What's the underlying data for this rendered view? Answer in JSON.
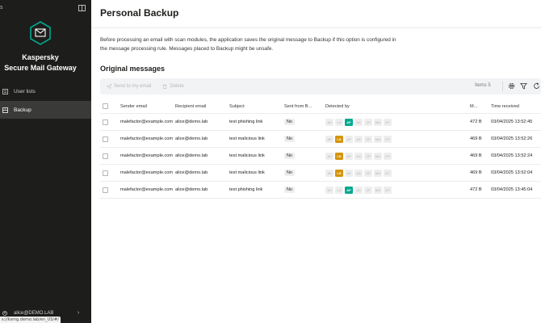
{
  "sidebar": {
    "top_left_glyph": "s",
    "brand_line1": "Kaspersky",
    "brand_line2": "Secure Mail Gateway",
    "items": [
      {
        "label": "User lists",
        "active": false
      },
      {
        "label": "Backup",
        "active": true
      }
    ],
    "user": "alice@DEMO.LAB"
  },
  "statusbar": {
    "url": "s://ksmg.demo.lab/en_US/#/"
  },
  "page": {
    "title": "Personal Backup",
    "description": "Before processing an email with scan modules, the application saves the original message to Backup if this option is configured in the message processing rule. Messages placed to Backup might be unsafe.",
    "section_title": "Original messages"
  },
  "toolbar": {
    "send_label": "Send to my email",
    "delete_label": "Delete",
    "items_count": "Items 5"
  },
  "table": {
    "columns": {
      "sender": "Sender email",
      "recipient": "Recipient email",
      "subject": "Subject",
      "sent": "Sent from B...",
      "detected": "Detected by",
      "size": "M...",
      "time": "Time received"
    },
    "module_labels": [
      "AV",
      "LS",
      "AP",
      "AS",
      "CF",
      "MA",
      "KT"
    ],
    "rows": [
      {
        "sender": "malefactor@example.com",
        "recipient": "alice@demo.lab",
        "subject": "test phishing link",
        "sent": "No",
        "active_module": "AP",
        "size": "472 B",
        "time": "03/04/2025 13:52:45"
      },
      {
        "sender": "malefactor@example.com",
        "recipient": "alice@demo.lab",
        "subject": "test malicious link",
        "sent": "No",
        "active_module": "LS",
        "size": "469 B",
        "time": "03/04/2025 13:52:26"
      },
      {
        "sender": "malefactor@example.com",
        "recipient": "alice@demo.lab",
        "subject": "test malicious link",
        "sent": "No",
        "active_module": "LS",
        "size": "469 B",
        "time": "03/04/2025 13:52:24"
      },
      {
        "sender": "malefactor@example.com",
        "recipient": "alice@demo.lab",
        "subject": "test malicious link",
        "sent": "No",
        "active_module": "LS",
        "size": "469 B",
        "time": "03/04/2025 13:52:04"
      },
      {
        "sender": "malefactor@example.com",
        "recipient": "alice@demo.lab",
        "subject": "test phishing link",
        "sent": "No",
        "active_module": "AP",
        "size": "472 B",
        "time": "03/04/2025 13:45:04"
      }
    ]
  },
  "colors": {
    "sidebar_bg": "#1d1d1b",
    "accent_ap": "#00a88e",
    "accent_ls": "#d4950a"
  },
  "icons": {
    "collapse": "sidebar-collapse-icon",
    "logo": "kaspersky-envelope-shield-icon",
    "user_lists": "list-icon",
    "backup": "backup-icon",
    "send": "paper-plane-icon",
    "delete": "trash-icon",
    "settings": "gear-icon",
    "filter": "filter-icon",
    "refresh": "refresh-icon"
  }
}
